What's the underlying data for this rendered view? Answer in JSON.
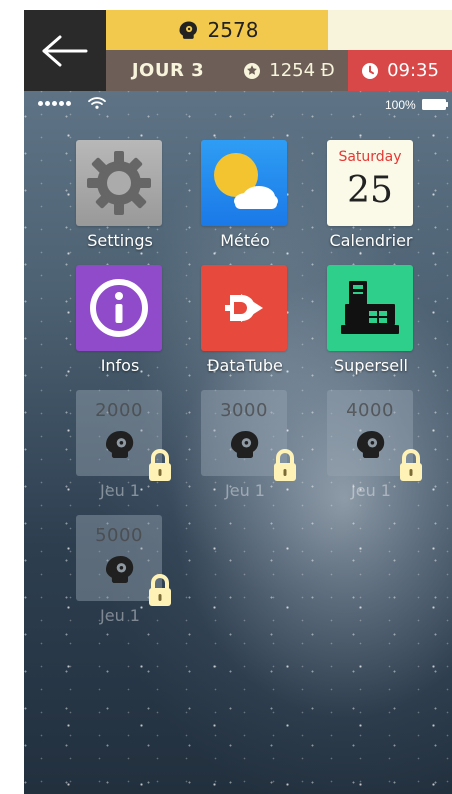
{
  "hud": {
    "back_icon": "arrow-left-icon",
    "coins": "2578",
    "day": "JOUR 3",
    "money": "1254 Đ",
    "time": "09:35",
    "colors": {
      "dark": "#2a2a2a",
      "yellow": "#f2c94c",
      "cream": "#f7f4db",
      "brown": "#6d5f57",
      "red": "#d84848"
    }
  },
  "phone": {
    "battery": "100%",
    "signal_icon": "signal-dots-icon",
    "wifi_icon": "wifi-icon",
    "battery_icon": "battery-icon"
  },
  "apps": [
    {
      "label": "Settings",
      "icon": "gear-icon"
    },
    {
      "label": "Météo",
      "icon": "weather-icon"
    },
    {
      "label": "Calendrier",
      "icon": "calendar-icon",
      "day_name": "Saturday",
      "day_num": "25"
    },
    {
      "label": "Infos",
      "icon": "info-icon"
    },
    {
      "label": "ĐataTube",
      "icon": "play-icon"
    },
    {
      "label": "Supersell",
      "icon": "cash-register-icon"
    }
  ],
  "locked_apps": [
    {
      "label": "Jeu 1",
      "price": "2000"
    },
    {
      "label": "Jeu 1",
      "price": "3000"
    },
    {
      "label": "Jeu 1",
      "price": "4000"
    },
    {
      "label": "Jeu 1",
      "price": "5000"
    }
  ]
}
